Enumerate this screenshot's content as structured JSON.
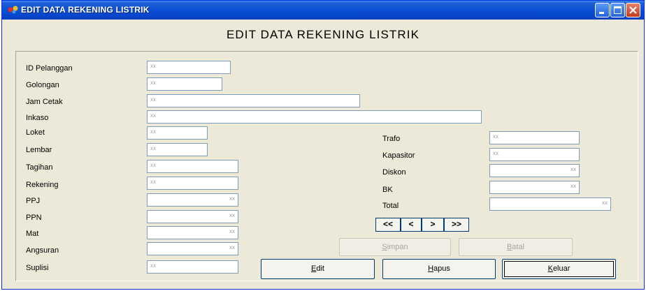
{
  "window": {
    "title": "EDIT DATA REKENING LISTRIK"
  },
  "form": {
    "heading": "EDIT DATA REKENING LISTRIK",
    "left_fields": [
      {
        "label": "ID Pelanggan",
        "value": "xx"
      },
      {
        "label": "Golongan",
        "value": "xx"
      },
      {
        "label": "Jam Cetak",
        "value": "xx"
      },
      {
        "label": "Inkaso",
        "value": "xx"
      },
      {
        "label": "Loket",
        "value": "xx"
      },
      {
        "label": "Lembar",
        "value": "xx"
      },
      {
        "label": "Tagihan",
        "value": "xx"
      },
      {
        "label": "Rekening",
        "value": "xx"
      },
      {
        "label": "PPJ",
        "value": "xx"
      },
      {
        "label": "PPN",
        "value": "xx"
      },
      {
        "label": "Mat",
        "value": "xx"
      },
      {
        "label": "Angsuran",
        "value": "xx"
      },
      {
        "label": "Suplisi",
        "value": "xx"
      }
    ],
    "right_fields": [
      {
        "label": "Trafo",
        "value": "xx"
      },
      {
        "label": "Kapasitor",
        "value": "xx"
      },
      {
        "label": "Diskon",
        "value": "xx"
      },
      {
        "label": "BK",
        "value": "xx"
      },
      {
        "label": "Total",
        "value": "xx"
      }
    ]
  },
  "nav": {
    "first": "<<",
    "prev": "<",
    "next": ">",
    "last": ">>"
  },
  "buttons": {
    "simpan_key": "S",
    "simpan_rest": "impan",
    "batal_key": "B",
    "batal_rest": "atal",
    "edit_key": "E",
    "edit_rest": "dit",
    "hapus_key": "H",
    "hapus_rest": "apus",
    "keluar_key": "K",
    "keluar_rest": "eluar"
  },
  "colors": {
    "titlebar": "#0a4fd3",
    "window_bg": "#ece9d8",
    "field_border": "#7f9db9"
  }
}
